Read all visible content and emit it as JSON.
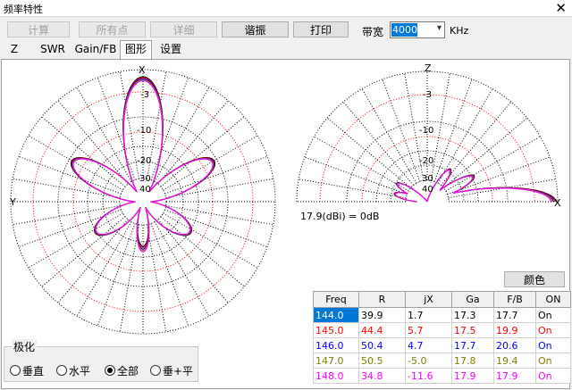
{
  "window": {
    "title": "频率特性",
    "close": "✕"
  },
  "toolbar": {
    "calc": "计算",
    "all_points": "所有点",
    "detail": "详细",
    "resonance": "谐振",
    "print": "打印",
    "bandwidth_label": "带宽",
    "bandwidth_value": "4000",
    "bandwidth_unit": "KHz"
  },
  "tabs": [
    "Z",
    "SWR",
    "Gain/FB",
    "图形",
    "设置"
  ],
  "active_tab": "图形",
  "left_plot": {
    "labels": {
      "top": "X",
      "left": "Y",
      "rings": [
        "-3",
        "-10",
        "-20",
        "30",
        "40"
      ]
    }
  },
  "right_plot": {
    "labels": {
      "top": "Z",
      "right": "X",
      "rings": [
        "-3",
        "-10",
        "-20",
        "30",
        "40"
      ]
    },
    "ref_text": "17.9(dBi) = 0dB"
  },
  "color_button": "颜色",
  "table": {
    "columns": [
      "Freq",
      "R",
      "jX",
      "Ga",
      "F/B",
      "ON"
    ],
    "rows": [
      {
        "Freq": "144.0",
        "R": "39.9",
        "jX": "1.7",
        "Ga": "17.3",
        "FB": "17.7",
        "ON": "On",
        "color": "#000000",
        "selected": true
      },
      {
        "Freq": "145.0",
        "R": "44.4",
        "jX": "5.7",
        "Ga": "17.5",
        "FB": "19.9",
        "ON": "On",
        "color": "#ff0000"
      },
      {
        "Freq": "146.0",
        "R": "50.4",
        "jX": "4.7",
        "Ga": "17.7",
        "FB": "20.6",
        "ON": "On",
        "color": "#0000ff"
      },
      {
        "Freq": "147.0",
        "R": "50.5",
        "jX": "-5.0",
        "Ga": "17.8",
        "FB": "19.4",
        "ON": "On",
        "color": "#808000"
      },
      {
        "Freq": "148.0",
        "R": "34.8",
        "jX": "-11.6",
        "Ga": "17.9",
        "FB": "17.9",
        "ON": "On",
        "color": "#ff00ff"
      }
    ]
  },
  "polarization": {
    "label": "极化",
    "options": [
      "垂直",
      "水平",
      "全部",
      "垂+平"
    ],
    "selected": "全部"
  },
  "colors": {
    "accent": "#0078d7",
    "grid_red": "#ff0000"
  }
}
